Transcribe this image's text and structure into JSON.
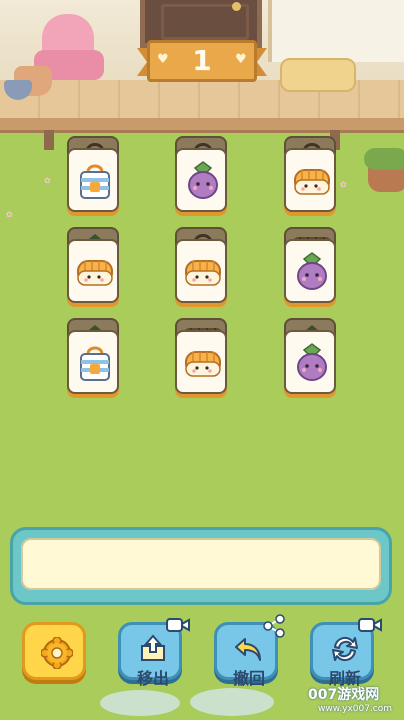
{
  "level": {
    "number": "1"
  },
  "tiles": [
    {
      "row": 0,
      "col": 0,
      "top_item": "bag",
      "under_item": "bag"
    },
    {
      "row": 0,
      "col": 1,
      "top_item": "eggplant",
      "under_item": "bag"
    },
    {
      "row": 0,
      "col": 2,
      "top_item": "bread",
      "under_item": "bag"
    },
    {
      "row": 1,
      "col": 0,
      "top_item": "bread",
      "under_item": "eggplant"
    },
    {
      "row": 1,
      "col": 1,
      "top_item": "bread",
      "under_item": "bag"
    },
    {
      "row": 1,
      "col": 2,
      "top_item": "eggplant",
      "under_item": "bread"
    },
    {
      "row": 2,
      "col": 0,
      "top_item": "bag",
      "under_item": "eggplant"
    },
    {
      "row": 2,
      "col": 1,
      "top_item": "bread",
      "under_item": "bread"
    },
    {
      "row": 2,
      "col": 2,
      "top_item": "eggplant",
      "under_item": "eggplant"
    }
  ],
  "tray": {
    "slots_filled": 0
  },
  "buttons": {
    "settings": {
      "icon": "gear-icon"
    },
    "remove": {
      "label": "移出",
      "icon": "box-up-icon",
      "badge": "video-icon"
    },
    "undo": {
      "label": "撤回",
      "icon": "undo-arrow-icon",
      "badge": "share-icon"
    },
    "refresh": {
      "label": "刷新",
      "icon": "refresh-icon",
      "badge": "video-icon"
    }
  },
  "watermark": {
    "text": "007游戏网",
    "url": "www.yx007.com"
  },
  "colors": {
    "grass": "#a9cc5a",
    "tile_border": "#6b5a3c",
    "tile_shadow": "#e2962e",
    "tray": "#6cc7c9",
    "banner": "#e9a84a"
  }
}
